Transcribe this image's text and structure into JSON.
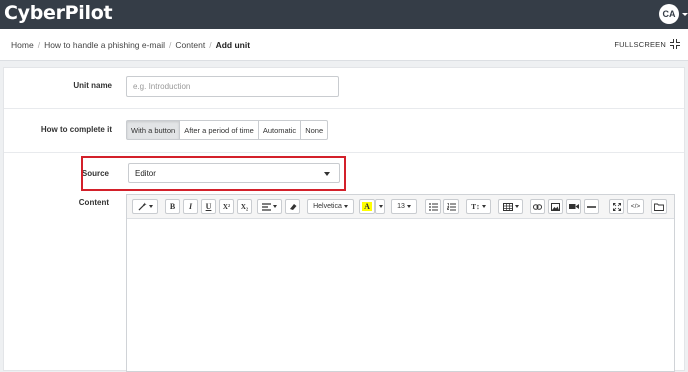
{
  "brand": {
    "logo_text": "CyberPilot"
  },
  "user": {
    "initials": "CA"
  },
  "breadcrumb": {
    "items": [
      "Home",
      "How to handle a phishing e-mail",
      "Content"
    ],
    "current": "Add unit"
  },
  "header": {
    "fullscreen_label": "FULLSCREEN"
  },
  "form": {
    "unit_name_label": "Unit name",
    "unit_name_placeholder": "e.g. Introduction",
    "unit_name_value": "",
    "complete_label": "How to complete it",
    "complete_options": [
      "With a button",
      "After a period of time",
      "Automatic",
      "None"
    ],
    "complete_selected": "With a button",
    "source_label": "Source",
    "source_value": "Editor",
    "content_label": "Content"
  },
  "editor_toolbar": {
    "font_family": "Helvetica",
    "font_size": "13",
    "bold": "B",
    "italic": "I",
    "underline": "U",
    "superscript": "X²",
    "subscript": "X₂",
    "highlight": "A",
    "line_height": "T↕",
    "code": "</>"
  },
  "colors": {
    "topbar": "#353d47",
    "highlight_box": "#d3202a",
    "text_highlight": "#ffff00"
  }
}
